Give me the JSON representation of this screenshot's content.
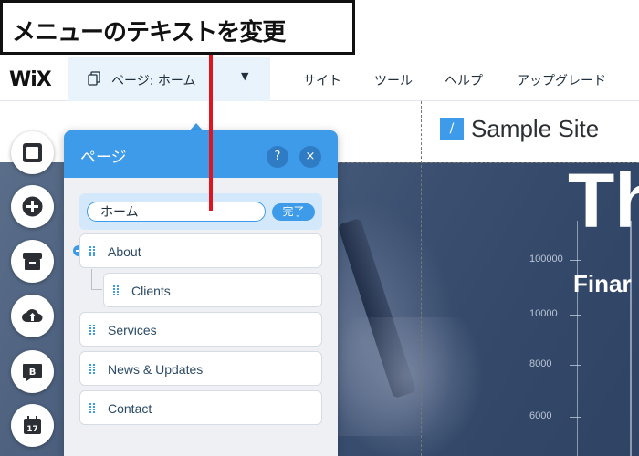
{
  "annotation": {
    "text": "メニューのテキストを変更"
  },
  "topbar": {
    "logo": "WiX",
    "page_selector": {
      "label": "ページ: ホーム"
    },
    "menu": [
      "サイト",
      "ツール",
      "ヘルプ",
      "アップグレード"
    ]
  },
  "site": {
    "logo_glyph": "/",
    "title": "Sample Site"
  },
  "hero": {
    "ticks": [
      "100000",
      "10000",
      "8000",
      "6000"
    ],
    "headline_fragment": "Th",
    "subheadline_fragment": "Finar"
  },
  "toolbar": {
    "tools": [
      "background-icon",
      "add-icon",
      "app-market-icon",
      "upload-icon",
      "blog-icon",
      "bookings-icon"
    ]
  },
  "pages_panel": {
    "title": "ページ",
    "help_label": "?",
    "close_label": "×",
    "edit": {
      "value": "ホーム",
      "done_label": "完了"
    },
    "pages": [
      {
        "label": "About"
      },
      {
        "label": "Clients"
      },
      {
        "label": "Services"
      },
      {
        "label": "News & Updates"
      },
      {
        "label": "Contact"
      }
    ]
  },
  "colors": {
    "accent": "#3d9be9",
    "panel_bg": "#eef0f3",
    "annotation_line": "#e0141e"
  }
}
